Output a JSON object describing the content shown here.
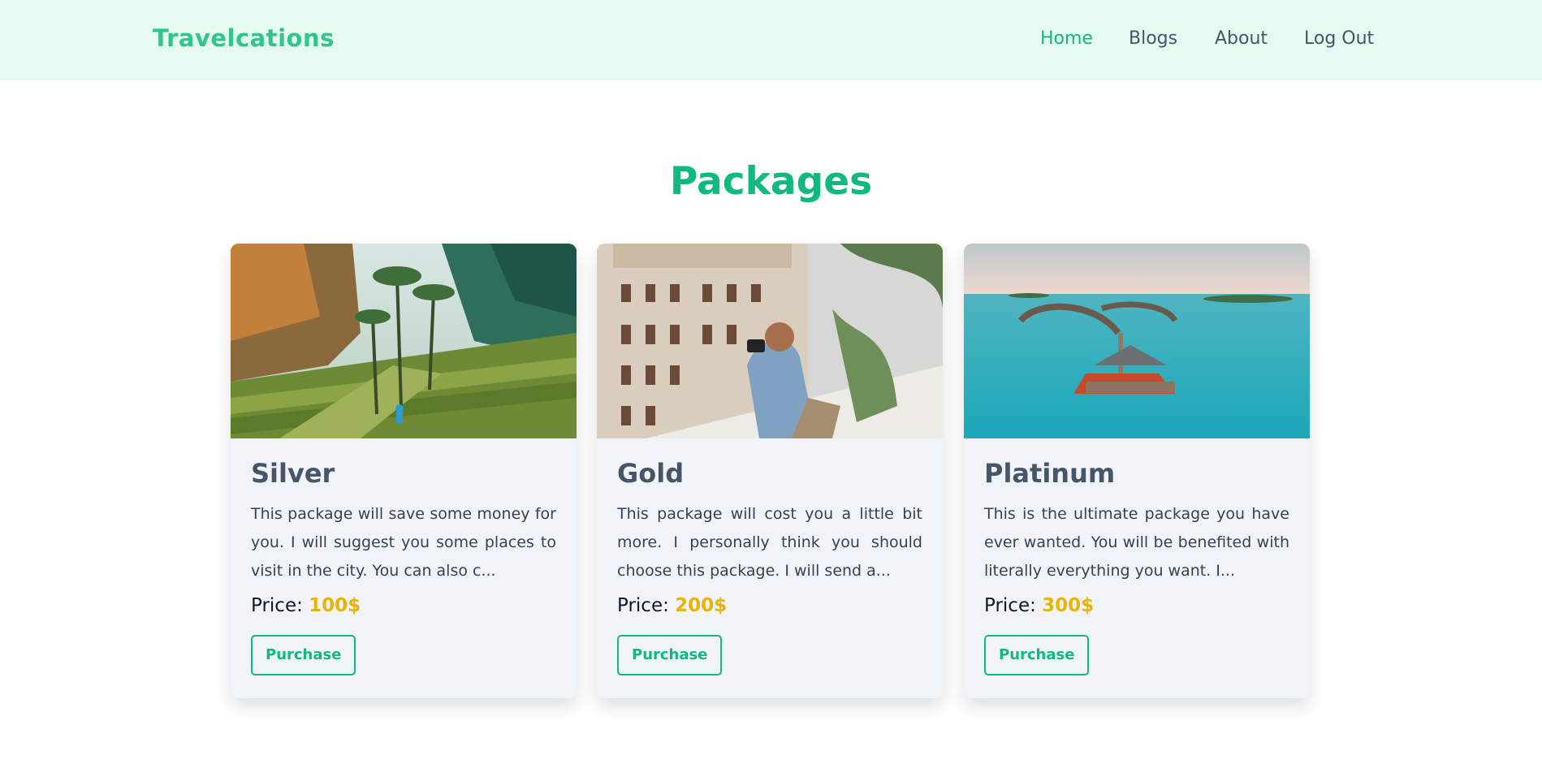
{
  "navbar": {
    "brand": "Travelcations",
    "links": [
      {
        "label": "Home",
        "active": true
      },
      {
        "label": "Blogs",
        "active": false
      },
      {
        "label": "About",
        "active": false
      },
      {
        "label": "Log Out",
        "active": false
      }
    ]
  },
  "packages": {
    "title": "Packages",
    "cards": [
      {
        "name": "Silver",
        "description": "This package will save some money for you. I will suggest you some places to visit in the city. You can also c...",
        "price_label": "Price: ",
        "price": "100$",
        "button": "Purchase",
        "image": "rice-terraces-photo"
      },
      {
        "name": "Gold",
        "description": "This package will cost you a little bit more. I personally think you should choose this package. I will send a...",
        "price_label": "Price: ",
        "price": "200$",
        "button": "Purchase",
        "image": "photographer-balcony-photo"
      },
      {
        "name": "Platinum",
        "description": "This is the ultimate package you have ever wanted. You will be benefited with literally everything you want. I...",
        "price_label": "Price: ",
        "price": "300$",
        "button": "Purchase",
        "image": "overwater-resort-photo"
      }
    ]
  },
  "colors": {
    "accent": "#10b981",
    "nav_bg": "#e6fbef",
    "price": "#eab308",
    "card_bg": "#f0f4f8"
  }
}
